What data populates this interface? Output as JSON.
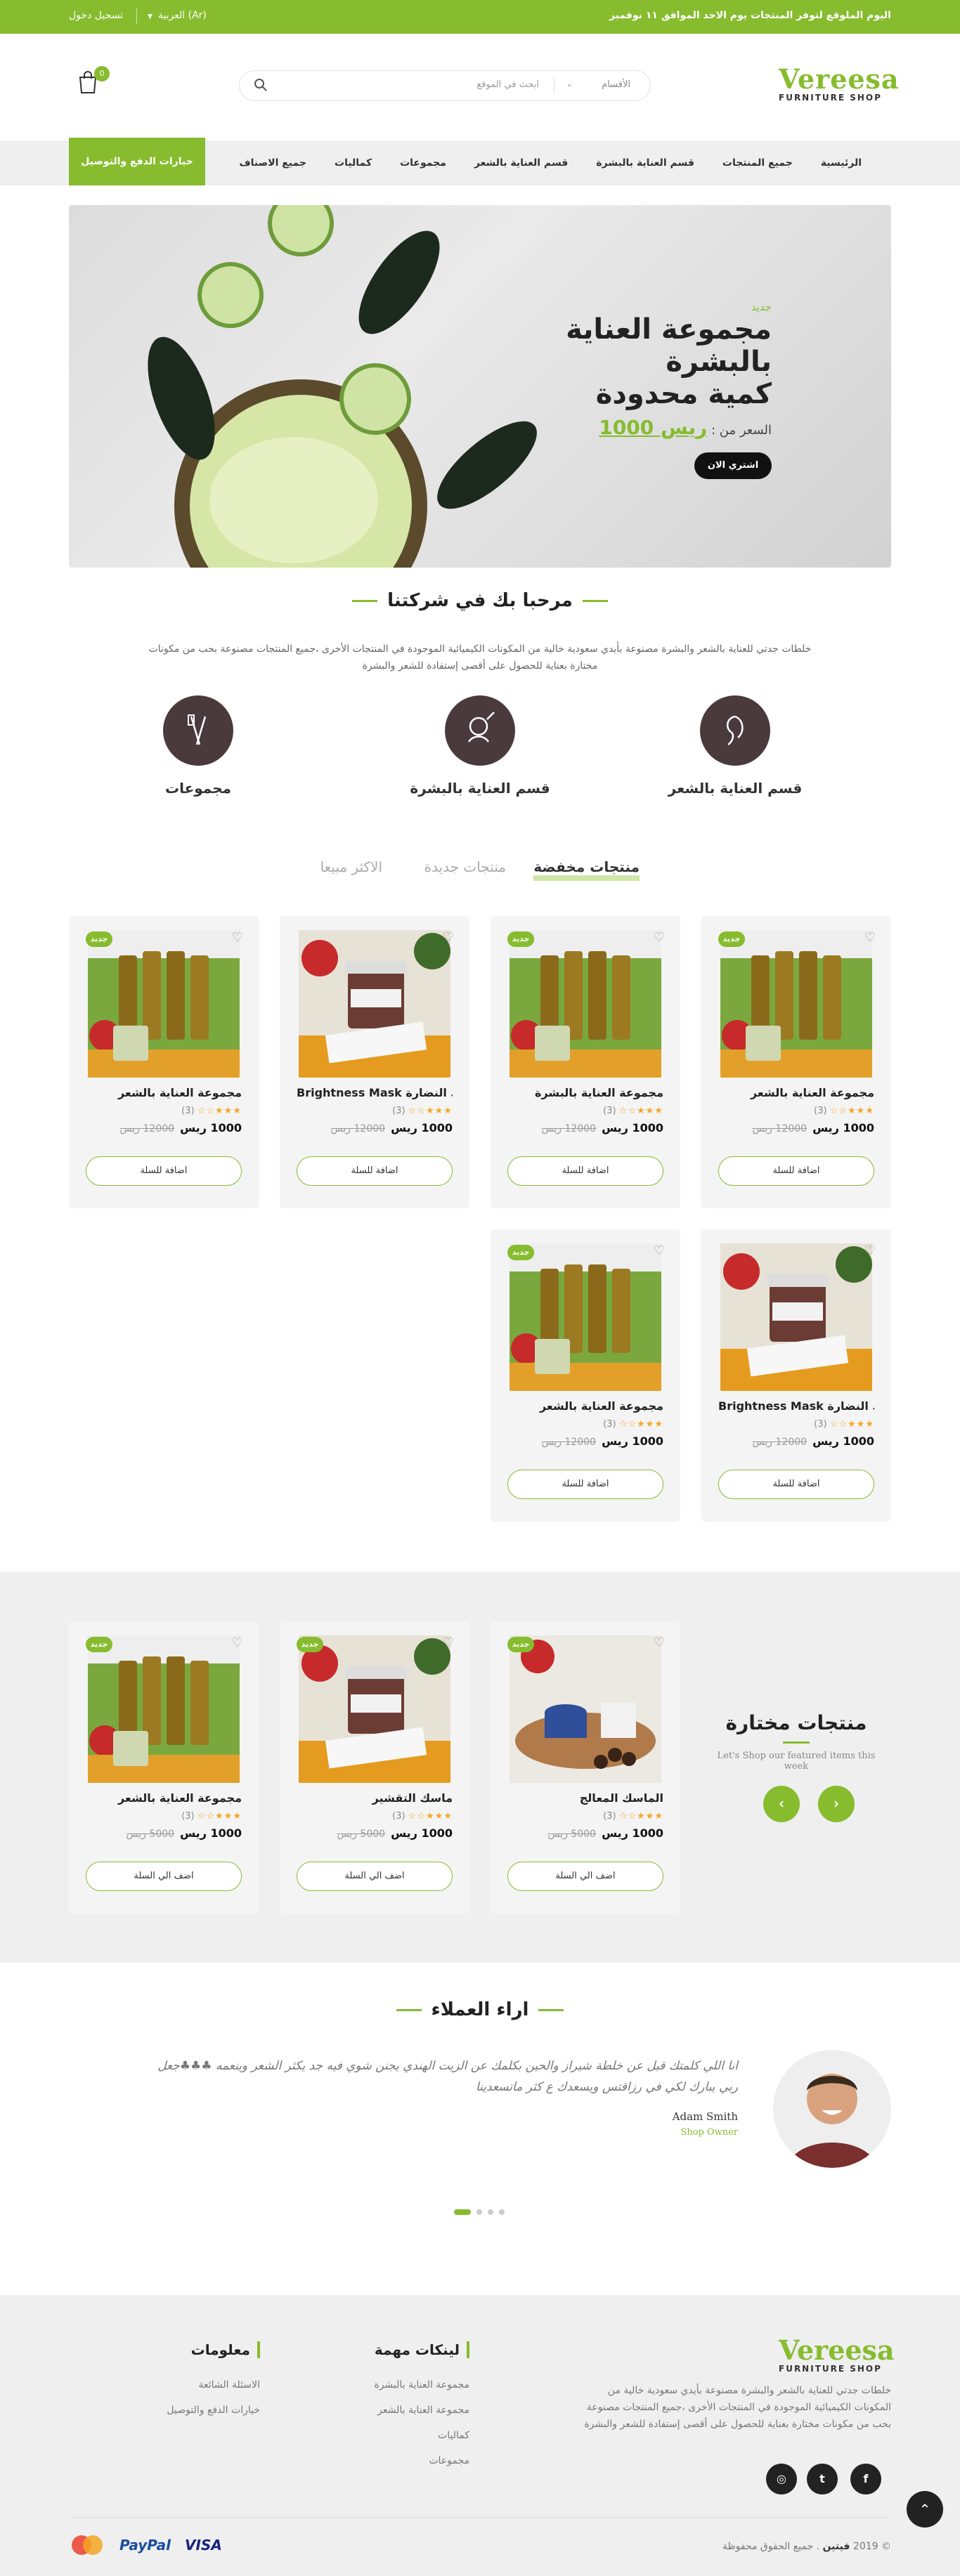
{
  "topbar": {
    "notice": "اليوم الملوقع لتوفر المنتجات يوم الاحد الموافق ١١ نوفمبر",
    "language": "العربية (Ar)",
    "login": "تسجيل دخول"
  },
  "header": {
    "logo_main": "Vereesa",
    "logo_sub": "FURNITURE SHOP",
    "search_category": "الأقسام",
    "search_placeholder": "ابحث في الموقع",
    "cart_count": "0"
  },
  "nav": {
    "items": [
      "الرئيسية",
      "جميع المنتجات",
      "قسم العناية بالبشرة",
      "قسم العناية بالشعر",
      "مجموعات",
      "كماليات",
      "جميع الاصناف"
    ],
    "payment_button": "خيارات الدفع والتوصيل"
  },
  "hero": {
    "badge": "جديد",
    "title_line1": "مجموعة العناية",
    "title_line2": "بالبشرة",
    "title_line3": "كمية محدودة",
    "price_label": "السعر من :",
    "price_value": "ريس 1000",
    "buy_button": "اشتري الان"
  },
  "welcome": {
    "title": "مرحبا بك في شركتنا",
    "text": "خلطات جدتي للعناية بالشعر والبشرة مصنوعة بأيدي سعودية خالية من المكونات الكيميائية الموجودة في المنتجات الأخرى ،جميع المنتجات مصنوعة بحب من مكونات مختارة بعناية للحصول على أقصى إستفادة للشعر والبشرة"
  },
  "features": [
    {
      "label": "قسم العناية بالشعر",
      "icon": "hair-icon"
    },
    {
      "label": "قسم العناية بالبشرة",
      "icon": "skincare-icon"
    },
    {
      "label": "مجموعات",
      "icon": "tools-icon"
    }
  ],
  "tabs": [
    "منتجات مخفضة",
    "منتجات جديدة",
    "الاكثر مبيعا"
  ],
  "products": [
    {
      "name": "مجموعة العناية بالشعر",
      "reviews": "(3)",
      "rating": 3,
      "price": "1000 ريس",
      "old_price": "12000 ريس",
      "button": "اضافة للسلة",
      "badge": "جديد",
      "img": "oil"
    },
    {
      "name": "مجموعة العناية بالبشرة",
      "reviews": "(3)",
      "rating": 3,
      "price": "1000 ريس",
      "old_price": "12000 ريس",
      "button": "اضافة للسلة",
      "badge": "جديد",
      "img": "oil"
    },
    {
      "name": "Brightness Mask ماسك النضارة",
      "reviews": "(3)",
      "rating": 3,
      "price": "1000 ريس",
      "old_price": "12000 ريس",
      "button": "اضافة للسلة",
      "badge": "",
      "img": "jar"
    },
    {
      "name": "مجموعة العناية بالشعر",
      "reviews": "(3)",
      "rating": 3,
      "price": "1000 ريس",
      "old_price": "12000 ريس",
      "button": "اضافة للسلة",
      "badge": "جديد",
      "img": "oil"
    },
    {
      "name": "Brightness Mask ماسك النضارة",
      "reviews": "(3)",
      "rating": 3,
      "price": "1000 ريس",
      "old_price": "12000 ريس",
      "button": "اضافة للسلة",
      "badge": "",
      "img": "jar"
    },
    {
      "name": "مجموعة العناية بالشعر",
      "reviews": "(3)",
      "rating": 3,
      "price": "1000 ريس",
      "old_price": "12000 ريس",
      "button": "اضافة للسلة",
      "badge": "جديد",
      "img": "oil"
    }
  ],
  "featured": {
    "title": "منتجات مختارة",
    "subtitle": "Let's Shop our featured items this week",
    "items": [
      {
        "name": "الماسك المعالج",
        "reviews": "(3)",
        "rating": 3,
        "price": "1000 ريس",
        "old_price": "5000 ريس",
        "button": "اضف الي السلة",
        "badge": "جديد",
        "img": "bowl"
      },
      {
        "name": "ماسك التقشير",
        "reviews": "(3)",
        "rating": 3,
        "price": "1000 ريس",
        "old_price": "5000 ريس",
        "button": "اضف الي السلة",
        "badge": "جديد",
        "img": "jar"
      },
      {
        "name": "مجموعة العناية بالشعر",
        "reviews": "(3)",
        "rating": 3,
        "price": "1000 ريس",
        "old_price": "5000 ريس",
        "button": "اضف الي السلة",
        "badge": "جديد",
        "img": "oil"
      }
    ]
  },
  "testimonials": {
    "title": "اراء العملاء",
    "quote": "انا اللي كلمتك قبل عن خلطة شيراز والحين بكلمك عن الزيت الهندي يجنن شوي فيه جد يكثر الشعر وينعمه ♣♣♣جعل ربي يبارك لكي في رزاقتس ويسعدك ع كثر ماتسعدينا",
    "author": "Adam Smith",
    "role": "Shop Owner"
  },
  "footer": {
    "about": "خلطات جدتي للعناية بالشعر والبشرة مصنوعة بأيدي سعودية خالية من المكونات الكيميائية الموجودة في المنتجات الأخرى ،جميع المنتجات مصنوعة بحب من مكونات مختارة بعناية للحصول على أقصى إستفادة للشعر والبشرة",
    "links_title": "لينكات مهمة",
    "links": [
      "مجموعة العناية بالبشرة",
      "مجموعة العناية بالشعر",
      "كماليات",
      "مجموعات"
    ],
    "info_title": "معلومات",
    "info": [
      "الاسئلة الشائعة",
      "خيارات الدفع والتوصيل"
    ],
    "copyright_pre": "© 2019",
    "brand": "فيتين",
    "copyright_post": ". جميع الحقوق محفوظة",
    "payments": [
      "mastercard",
      "PayPal",
      "VISA"
    ]
  },
  "colors": {
    "accent": "#86bc2e",
    "dark": "#222222",
    "feature_circle": "#4a3a3c"
  }
}
